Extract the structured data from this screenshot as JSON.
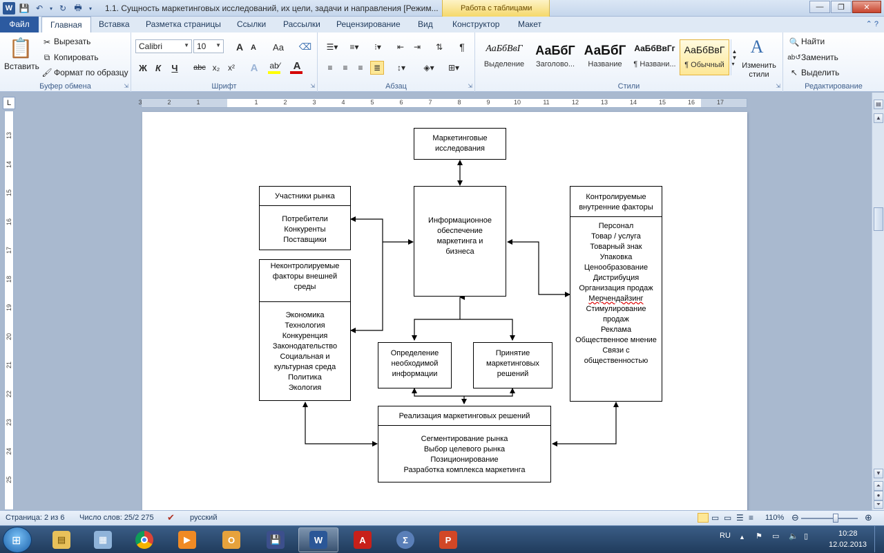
{
  "window": {
    "title": "1.1. Сущность маркетинговых исследований, их цели, задачи и направления [Режим...",
    "contextual_tab": "Работа с таблицами"
  },
  "tabs": [
    "Файл",
    "Главная",
    "Вставка",
    "Разметка страницы",
    "Ссылки",
    "Рассылки",
    "Рецензирование",
    "Вид",
    "Конструктор",
    "Макет"
  ],
  "ribbon": {
    "clipboard": {
      "group": "Буфер обмена",
      "paste": "Вставить",
      "cut": "Вырезать",
      "copy": "Копировать",
      "format_painter": "Формат по образцу"
    },
    "font": {
      "group": "Шрифт",
      "font_name": "Calibri",
      "font_size": "10",
      "bold": "Ж",
      "italic": "К",
      "underline": "Ч",
      "strike": "abc",
      "sub": "x₂",
      "sup": "x²",
      "grow": "A",
      "shrink": "A",
      "case": "Aa"
    },
    "paragraph": {
      "group": "Абзац"
    },
    "styles": {
      "group": "Стили",
      "items": [
        {
          "sample": "АаБбВвГ",
          "name": "Выделение"
        },
        {
          "sample": "АаБбГ",
          "name": "Заголово..."
        },
        {
          "sample": "АаБбГ",
          "name": "Название"
        },
        {
          "sample": "АаБбВвГг",
          "name": "¶ Названи..."
        },
        {
          "sample": "АаБбВвГ",
          "name": "¶ Обычный"
        }
      ],
      "change_styles": "Изменить стили"
    },
    "editing": {
      "group": "Редактирование",
      "find": "Найти",
      "replace": "Заменить",
      "select": "Выделить"
    }
  },
  "ruler": {
    "h_ticks": [
      "3",
      "2",
      "1",
      "1",
      "2",
      "3",
      "4",
      "5",
      "6",
      "7",
      "8",
      "9",
      "10",
      "11",
      "12",
      "13",
      "14",
      "15",
      "16",
      "17"
    ],
    "v_ticks": [
      "13",
      "14",
      "15",
      "16",
      "17",
      "18",
      "19",
      "20",
      "21",
      "22",
      "23",
      "24",
      "25"
    ]
  },
  "diagram": {
    "research": "Маркетинговые исследования",
    "info_support": "Информационное обеспечение маркетинга и бизнеса",
    "market_participants": {
      "title": "Участники рынка",
      "items": [
        "Потребители",
        "Конкуренты",
        "Поставщики"
      ]
    },
    "uncontrollable": {
      "title": "Неконтролируемые факторы внешней среды",
      "items": [
        "Экономика",
        "Технология",
        "Конкуренция",
        "Законодательство",
        "Социальная и культурная среда",
        "Политика",
        "Экология"
      ]
    },
    "controllable": {
      "title": "Контролируемые внутренние факторы",
      "items": [
        "Персонал",
        "Товар / услуга",
        "Товарный знак",
        "Упаковка",
        "Ценообразование",
        "Дистрибуция",
        "Организация продаж",
        "Мерчендайзинг",
        "Стимулирование продаж",
        "Реклама",
        "Общественное мнение",
        "Связи с общественностью"
      ]
    },
    "define_info": "Определение необходимой информации",
    "decisions": "Принятие маркетинговых решений",
    "implementation": {
      "title": "Реализация маркетинговых решений",
      "items": [
        "Сегментирование рынка",
        "Выбор целевого рынка",
        "Позиционирование",
        "Разработка комплекса маркетинга"
      ]
    }
  },
  "status": {
    "page": "Страница: 2 из 6",
    "words": "Число слов: 25/2 275",
    "language": "русский",
    "zoom": "110%"
  },
  "tray": {
    "lang": "RU",
    "time": "10:28",
    "date": "12.02.2013"
  },
  "colors": {
    "accent": "#2c5aa0",
    "tools_tab": "#f5d86a",
    "font_color": "#d40000",
    "highlight": "#ffff00"
  }
}
